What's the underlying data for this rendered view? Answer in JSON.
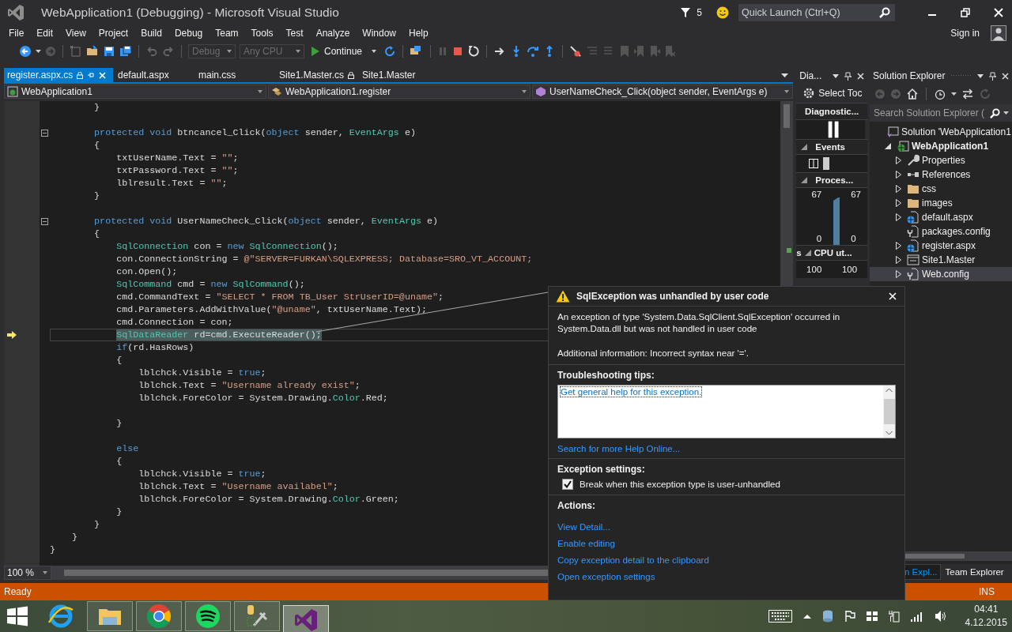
{
  "window": {
    "title": "WebApplication1 (Debugging) - Microsoft Visual Studio",
    "notification_count": "5",
    "quick_launch": {
      "placeholder": "Quick Launch (Ctrl+Q)"
    }
  },
  "menu": [
    "File",
    "Edit",
    "View",
    "Project",
    "Build",
    "Debug",
    "Team",
    "Tools",
    "Test",
    "Analyze",
    "Window",
    "Help"
  ],
  "account": {
    "sign_in": "Sign in"
  },
  "toolbar": {
    "configuration": {
      "value": "Debug",
      "disabled": true
    },
    "platform": {
      "value": "Any CPU",
      "disabled": true
    },
    "continue": "Continue"
  },
  "tabs": [
    {
      "label": "register.aspx.cs",
      "selected": true,
      "locked": true
    },
    {
      "label": "default.aspx",
      "selected": false,
      "locked": false
    },
    {
      "label": "main.css",
      "selected": false,
      "locked": false
    },
    {
      "label": "Site1.Master.cs",
      "selected": false,
      "locked": true
    },
    {
      "label": "Site1.Master",
      "selected": false,
      "locked": false
    }
  ],
  "nav_bar": {
    "project": "WebApplication1",
    "class": "WebApplication1.register",
    "member": "UserNameCheck_Click(object sender, EventArgs e)"
  },
  "editor": {
    "zoom": "100 %",
    "lines": [
      {
        "current": false,
        "fold": false,
        "tokens": [
          {
            "kind": "plain",
            "text": "        }"
          }
        ]
      },
      {
        "current": false,
        "fold": false
      },
      {
        "current": false,
        "fold": true,
        "tokens": [
          {
            "kind": "keyword",
            "text": "        protected void"
          },
          {
            "kind": "plain",
            "text": " btncancel_Click("
          },
          {
            "kind": "keyword",
            "text": "object"
          },
          {
            "kind": "plain",
            "text": " sender, "
          },
          {
            "kind": "type",
            "text": "EventArgs"
          },
          {
            "kind": "plain",
            "text": " e)"
          }
        ]
      },
      {
        "current": false,
        "fold": false,
        "tokens": [
          {
            "kind": "plain",
            "text": "        {"
          }
        ]
      },
      {
        "current": false,
        "fold": false,
        "tokens": [
          {
            "kind": "plain",
            "text": "            txtUserName.Text = "
          },
          {
            "kind": "string",
            "text": "\"\""
          },
          {
            "kind": "plain",
            "text": ";"
          }
        ]
      },
      {
        "current": false,
        "fold": false,
        "tokens": [
          {
            "kind": "plain",
            "text": "            txtPassword.Text = "
          },
          {
            "kind": "string",
            "text": "\"\""
          },
          {
            "kind": "plain",
            "text": ";"
          }
        ]
      },
      {
        "current": false,
        "fold": false,
        "tokens": [
          {
            "kind": "plain",
            "text": "            lblresult.Text = "
          },
          {
            "kind": "string",
            "text": "\"\""
          },
          {
            "kind": "plain",
            "text": ";"
          }
        ]
      },
      {
        "current": false,
        "fold": false,
        "tokens": [
          {
            "kind": "plain",
            "text": "        }"
          }
        ]
      },
      {
        "current": false,
        "fold": false
      },
      {
        "current": false,
        "fold": true,
        "tokens": [
          {
            "kind": "keyword",
            "text": "        protected void"
          },
          {
            "kind": "plain",
            "text": " UserNameCheck_Click("
          },
          {
            "kind": "keyword",
            "text": "object"
          },
          {
            "kind": "plain",
            "text": " sender, "
          },
          {
            "kind": "type",
            "text": "EventArgs"
          },
          {
            "kind": "plain",
            "text": " e)"
          }
        ]
      },
      {
        "current": false,
        "fold": false,
        "tokens": [
          {
            "kind": "plain",
            "text": "        {"
          }
        ]
      },
      {
        "current": false,
        "fold": false,
        "tokens": [
          {
            "kind": "type",
            "text": "            SqlConnection"
          },
          {
            "kind": "plain",
            "text": " con = "
          },
          {
            "kind": "keyword",
            "text": "new "
          },
          {
            "kind": "type",
            "text": "SqlConnection"
          },
          {
            "kind": "plain",
            "text": "();"
          }
        ]
      },
      {
        "current": false,
        "fold": false,
        "tokens": [
          {
            "kind": "plain",
            "text": "            con.ConnectionString = "
          },
          {
            "kind": "string",
            "text": "@\"SERVER=FURKAN\\SQLEXPRESS; Database=SRO_VT_ACCOUNT;"
          }
        ]
      },
      {
        "current": false,
        "fold": false,
        "tokens": [
          {
            "kind": "plain",
            "text": "            con.Open();"
          }
        ]
      },
      {
        "current": false,
        "fold": false,
        "tokens": [
          {
            "kind": "type",
            "text": "            SqlCommand"
          },
          {
            "kind": "plain",
            "text": " cmd = "
          },
          {
            "kind": "keyword",
            "text": "new "
          },
          {
            "kind": "type",
            "text": "SqlCommand"
          },
          {
            "kind": "plain",
            "text": "();"
          }
        ]
      },
      {
        "current": false,
        "fold": false,
        "tokens": [
          {
            "kind": "plain",
            "text": "            cmd.CommandText = "
          },
          {
            "kind": "string",
            "text": "\"SELECT * FROM TB_User StrUserID=@uname\""
          },
          {
            "kind": "plain",
            "text": ";"
          }
        ]
      },
      {
        "current": false,
        "fold": false,
        "tokens": [
          {
            "kind": "plain",
            "text": "            cmd.Parameters.AddWithValue("
          },
          {
            "kind": "string",
            "text": "\"@uname\""
          },
          {
            "kind": "plain",
            "text": ", txtUserName.Text);"
          }
        ]
      },
      {
        "current": false,
        "fold": false,
        "tokens": [
          {
            "kind": "plain",
            "text": "            cmd.Connection = con;"
          }
        ]
      },
      {
        "current": true,
        "fold": false,
        "tokens": [
          {
            "kind": "type",
            "text": "            SqlDataReader"
          },
          {
            "kind": "plain",
            "text": " rd=cmd.ExecuteReader();"
          }
        ]
      },
      {
        "current": false,
        "fold": false,
        "tokens": [
          {
            "kind": "keyword",
            "text": "            if"
          },
          {
            "kind": "plain",
            "text": "(rd.HasRows)"
          }
        ]
      },
      {
        "current": false,
        "fold": false,
        "tokens": [
          {
            "kind": "plain",
            "text": "            {"
          }
        ]
      },
      {
        "current": false,
        "fold": false,
        "tokens": [
          {
            "kind": "plain",
            "text": "                lblchck.Visible = "
          },
          {
            "kind": "keyword",
            "text": "true"
          },
          {
            "kind": "plain",
            "text": ";"
          }
        ]
      },
      {
        "current": false,
        "fold": false,
        "tokens": [
          {
            "kind": "plain",
            "text": "                lblchck.Text = "
          },
          {
            "kind": "string",
            "text": "\"Username already exist\""
          },
          {
            "kind": "plain",
            "text": ";"
          }
        ]
      },
      {
        "current": false,
        "fold": false,
        "tokens": [
          {
            "kind": "plain",
            "text": "                lblchck.ForeColor = System.Drawing."
          },
          {
            "kind": "type",
            "text": "Color"
          },
          {
            "kind": "plain",
            "text": ".Red;"
          }
        ]
      },
      {
        "current": false,
        "fold": false
      },
      {
        "current": false,
        "fold": false,
        "tokens": [
          {
            "kind": "plain",
            "text": "            }"
          }
        ]
      },
      {
        "current": false,
        "fold": false
      },
      {
        "current": false,
        "fold": false,
        "tokens": [
          {
            "kind": "keyword",
            "text": "            else"
          }
        ]
      },
      {
        "current": false,
        "fold": false,
        "tokens": [
          {
            "kind": "plain",
            "text": "            {"
          }
        ]
      },
      {
        "current": false,
        "fold": false,
        "tokens": [
          {
            "kind": "plain",
            "text": "                lblchck.Visible = "
          },
          {
            "kind": "keyword",
            "text": "true"
          },
          {
            "kind": "plain",
            "text": ";"
          }
        ]
      },
      {
        "current": false,
        "fold": false,
        "tokens": [
          {
            "kind": "plain",
            "text": "                lblchck.Text = "
          },
          {
            "kind": "string",
            "text": "\"Username availabel\""
          },
          {
            "kind": "plain",
            "text": ";"
          }
        ]
      },
      {
        "current": false,
        "fold": false,
        "tokens": [
          {
            "kind": "plain",
            "text": "                lblchck.ForeColor = System.Drawing."
          },
          {
            "kind": "type",
            "text": "Color"
          },
          {
            "kind": "plain",
            "text": ".Green;"
          }
        ]
      },
      {
        "current": false,
        "fold": false,
        "tokens": [
          {
            "kind": "plain",
            "text": "            }"
          }
        ]
      },
      {
        "current": false,
        "fold": false,
        "tokens": [
          {
            "kind": "plain",
            "text": "        }"
          }
        ]
      },
      {
        "current": false,
        "fold": false,
        "tokens": [
          {
            "kind": "plain",
            "text": "    }"
          }
        ]
      },
      {
        "current": false,
        "fold": false,
        "tokens": [
          {
            "kind": "plain",
            "text": "}"
          }
        ]
      }
    ]
  },
  "diagnostics": {
    "title": "Dia...",
    "select_tools": "Select Toc",
    "session_label": "Diagnostic...",
    "events_label": "Events",
    "memory": {
      "label": "Proces...",
      "left_max": "67",
      "right_max": "67",
      "left_min": "0",
      "right_min": "0"
    },
    "cpu": {
      "cut_label": "s",
      "label": "CPU ut...",
      "left_max": "100",
      "right_max": "100"
    }
  },
  "solution_explorer": {
    "title": "Solution Explorer",
    "search": {
      "placeholder": "Search Solution Explorer ("
    },
    "tree": [
      {
        "label": "Solution 'WebApplication1",
        "kind": "solution",
        "expandable": false,
        "selected": false,
        "children": [
          {
            "label": "WebApplication1",
            "kind": "project",
            "expandable": true,
            "expanded": true,
            "selected": false,
            "children": [
              {
                "label": "Properties",
                "kind": "properties",
                "expandable": true,
                "expanded": false,
                "selected": false
              },
              {
                "label": "References",
                "kind": "references",
                "expandable": true,
                "expanded": false,
                "selected": false
              },
              {
                "label": "css",
                "kind": "folder",
                "expandable": true,
                "expanded": false,
                "selected": false
              },
              {
                "label": "images",
                "kind": "folder",
                "expandable": true,
                "expanded": false,
                "selected": false
              },
              {
                "label": "default.aspx",
                "kind": "webform",
                "expandable": true,
                "expanded": false,
                "selected": false
              },
              {
                "label": "packages.config",
                "kind": "config",
                "expandable": false,
                "selected": false
              },
              {
                "label": "register.aspx",
                "kind": "webform",
                "expandable": true,
                "expanded": false,
                "selected": false
              },
              {
                "label": "Site1.Master",
                "kind": "master",
                "expandable": true,
                "expanded": false,
                "selected": false
              },
              {
                "label": "Web.config",
                "kind": "config",
                "expandable": true,
                "expanded": false,
                "selected": true
              }
            ]
          }
        ]
      }
    ]
  },
  "bottom_tabs": [
    {
      "label": "n Expl...",
      "selected": true
    },
    {
      "label": "Team Explorer",
      "selected": false
    }
  ],
  "status_bar": {
    "message": "Ready",
    "mode": "INS"
  },
  "exception": {
    "title": "SqlException was unhandled by user code",
    "message": "An exception of type 'System.Data.SqlClient.SqlException' occurred in System.Data.dll but was not handled in user code",
    "additional": "Additional information: Incorrect syntax near '='.",
    "tips_heading": "Troubleshooting tips:",
    "tips": [
      "Get general help for this exception."
    ],
    "search_link": "Search for more Help Online...",
    "settings_heading": "Exception settings:",
    "break_option": {
      "label": "Break when this exception type is user-unhandled",
      "checked": true
    },
    "actions_heading": "Actions:",
    "actions": [
      "View Detail...",
      "Enable editing",
      "Copy exception detail to the clipboard",
      "Open exception settings"
    ]
  },
  "taskbar": {
    "apps": [
      {
        "kind": "browser-e",
        "running": false,
        "selected": false
      },
      {
        "kind": "files",
        "running": true,
        "selected": false
      },
      {
        "kind": "browser-ring",
        "running": true,
        "selected": false
      },
      {
        "kind": "music",
        "running": true,
        "selected": false
      },
      {
        "kind": "tools",
        "running": true,
        "selected": false
      },
      {
        "kind": "ide",
        "running": true,
        "selected": true
      }
    ],
    "clock": {
      "time": "04:41",
      "date": "4.12.2015"
    }
  }
}
